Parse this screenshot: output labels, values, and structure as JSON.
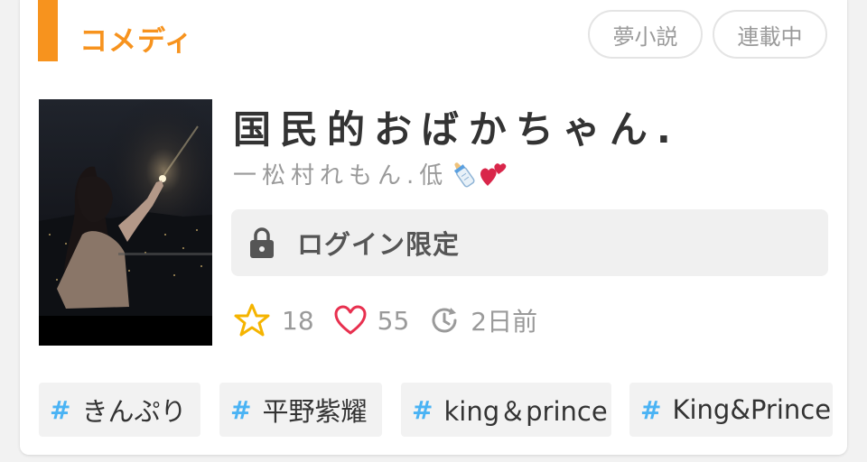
{
  "genre": {
    "label": "コメディ",
    "accent_color": "#f7931e"
  },
  "badges": {
    "type": "夢小説",
    "status": "連載中"
  },
  "story": {
    "title": "国民的おばかちゃん.",
    "author": "一松村れもん.低",
    "author_emojis": [
      "baby-bottle-icon",
      "two-hearts-icon"
    ],
    "access_label": "ログイン限定",
    "access_icon": "lock-icon"
  },
  "stats": {
    "stars": "18",
    "likes": "55",
    "updated": "2日前",
    "star_color": "#f5b400",
    "heart_color": "#e8304f"
  },
  "tags": [
    {
      "hash": "#",
      "label": "きんぷり"
    },
    {
      "hash": "#",
      "label": "平野紫耀"
    },
    {
      "hash": "#",
      "label": "king＆prince"
    },
    {
      "hash": "#",
      "label": "King&Prince"
    }
  ],
  "tag_hash_color": "#4ab3f4"
}
